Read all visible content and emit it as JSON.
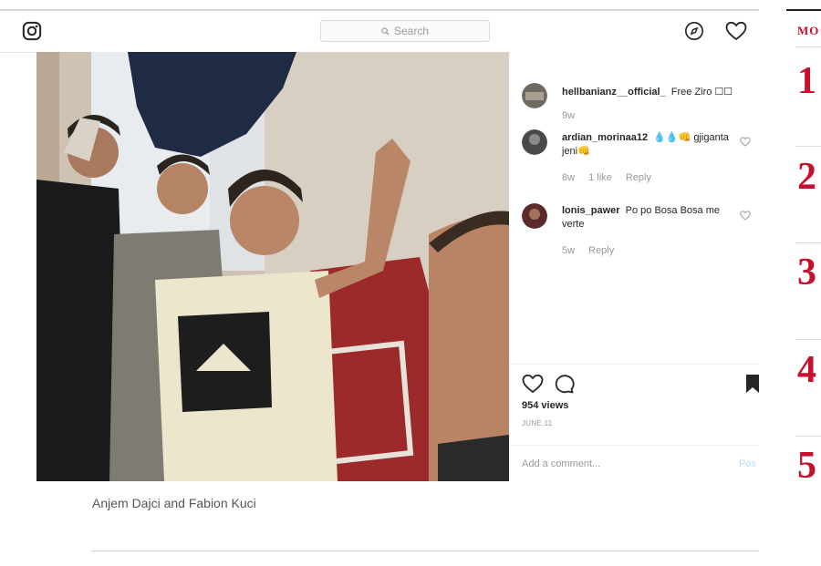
{
  "search": {
    "placeholder": "Search"
  },
  "comments": [
    {
      "username": "hellbanianz__official_",
      "text": "Free Ziro ☐☐",
      "time": "9w",
      "likes": "",
      "reply": ""
    },
    {
      "username": "ardian_morinaa12",
      "text": "💧💧👊 gjiganta jeni👊",
      "time": "8w",
      "likes": "1 like",
      "reply": "Reply"
    },
    {
      "username": "lonis_pawer",
      "text": "Po po Bosa Bosa me verte",
      "time": "5w",
      "likes": "",
      "reply": "Reply"
    }
  ],
  "post": {
    "views": "954 views",
    "date": "JUNE 11",
    "add_comment_placeholder": "Add a comment...",
    "post_label": "Pos"
  },
  "caption": "Anjem Dajci and Fabion Kuci",
  "rail": {
    "title": "MO",
    "ranks": [
      "1",
      "2",
      "3",
      "4",
      "5"
    ]
  },
  "colors": {
    "accent_red": "#c8102e",
    "link_blue": "#b2dffc"
  }
}
